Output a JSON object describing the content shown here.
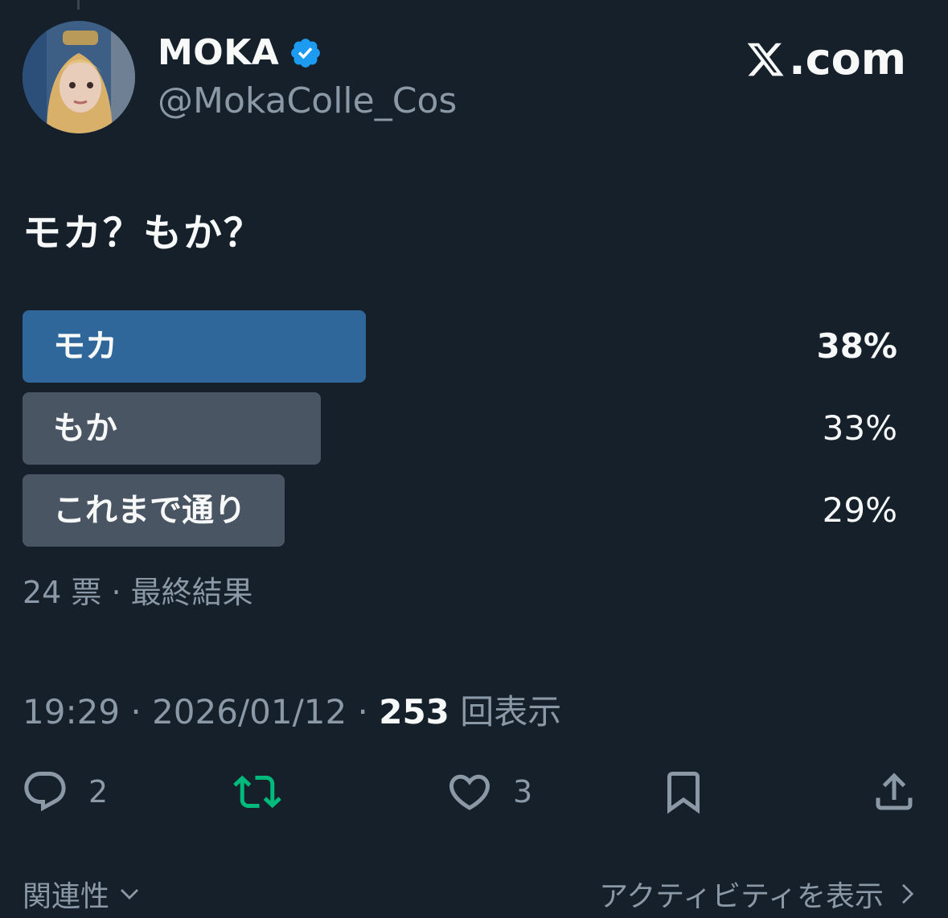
{
  "author": {
    "display_name": "MOKA",
    "handle": "@MokaColle_Cos",
    "verified_icon": "verified-badge-icon"
  },
  "brand": {
    "text": ".com",
    "logo_icon": "x-logo-icon"
  },
  "tweet": {
    "text": "モカ？もか？"
  },
  "poll": {
    "options": [
      {
        "label": "モカ",
        "percent_text": "38%",
        "percent": 38,
        "winner": true
      },
      {
        "label": "もか",
        "percent_text": "33%",
        "percent": 33,
        "winner": false
      },
      {
        "label": "これまで通り",
        "percent_text": "29%",
        "percent": 29,
        "winner": false
      }
    ],
    "meta": "24 票 · 最終結果"
  },
  "timestamp": {
    "time_date": "19:29 · 2026/01/12 · ",
    "views_count": "253",
    "views_label": " 回表示"
  },
  "actions": {
    "reply_count": "2",
    "like_count": "3"
  },
  "footer": {
    "relevance_label": "関連性",
    "activity_label": "アクティビティを表示"
  },
  "colors": {
    "background": "#15202b",
    "poll_winner": "#30679b",
    "poll_other": "#4a5563",
    "retweet_active": "#00ba7c",
    "verified": "#1d9bf0",
    "muted_text": "#8b98a5"
  }
}
